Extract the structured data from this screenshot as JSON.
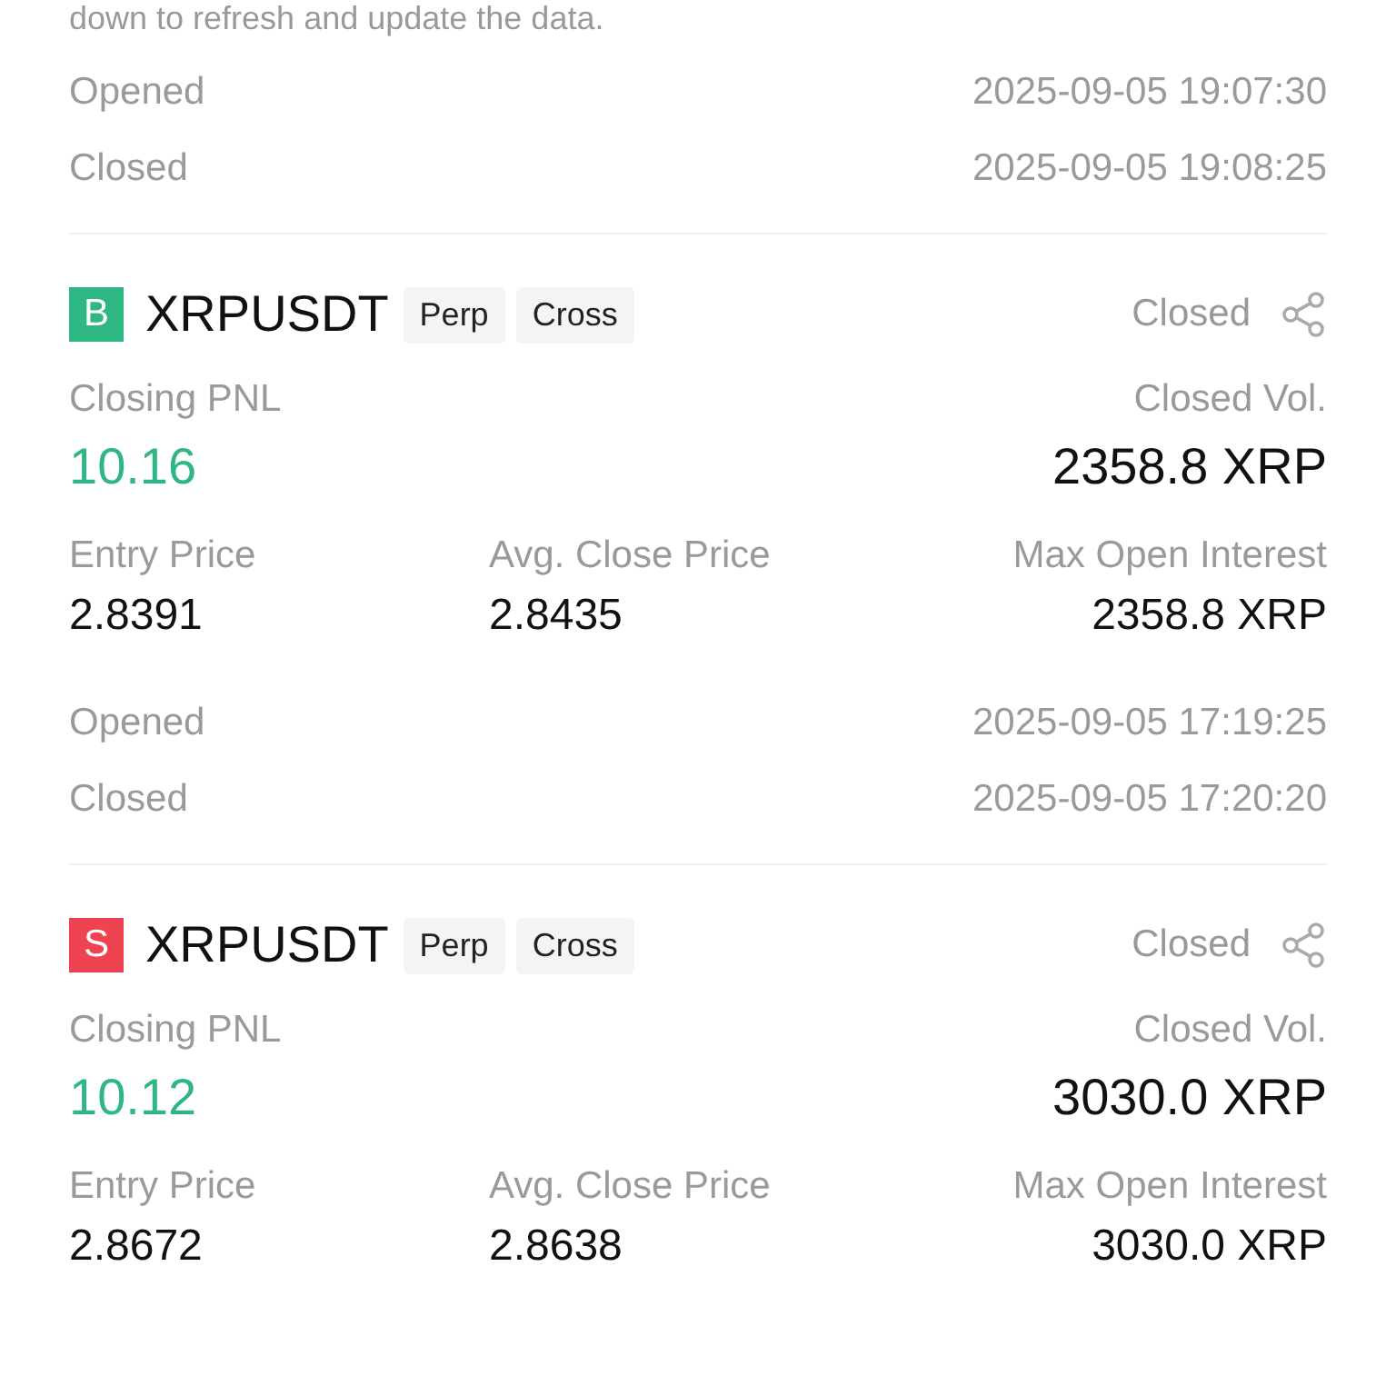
{
  "notice": "down to refresh and update the data.",
  "partial_trade": {
    "times": [
      {
        "label": "Opened",
        "value": "2025-09-05 19:07:30"
      },
      {
        "label": "Closed",
        "value": "2025-09-05 19:08:25"
      }
    ]
  },
  "trades": [
    {
      "side": "B",
      "kind": "buy",
      "symbol": "XRPUSDT",
      "tags": [
        "Perp",
        "Cross"
      ],
      "status": "Closed",
      "pnl_label": "Closing PNL",
      "pnl": "10.16",
      "vol_label": "Closed Vol.",
      "vol": "2358.8 XRP",
      "entry_label": "Entry Price",
      "entry": "2.8391",
      "avg_label": "Avg. Close Price",
      "avg": "2.8435",
      "max_label": "Max Open Interest",
      "max": "2358.8 XRP",
      "times": [
        {
          "label": "Opened",
          "value": "2025-09-05 17:19:25"
        },
        {
          "label": "Closed",
          "value": "2025-09-05 17:20:20"
        }
      ]
    },
    {
      "side": "S",
      "kind": "sell",
      "symbol": "XRPUSDT",
      "tags": [
        "Perp",
        "Cross"
      ],
      "status": "Closed",
      "pnl_label": "Closing PNL",
      "pnl": "10.12",
      "vol_label": "Closed Vol.",
      "vol": "3030.0 XRP",
      "entry_label": "Entry Price",
      "entry": "2.8672",
      "avg_label": "Avg. Close Price",
      "avg": "2.8638",
      "max_label": "Max Open Interest",
      "max": "3030.0 XRP"
    }
  ]
}
